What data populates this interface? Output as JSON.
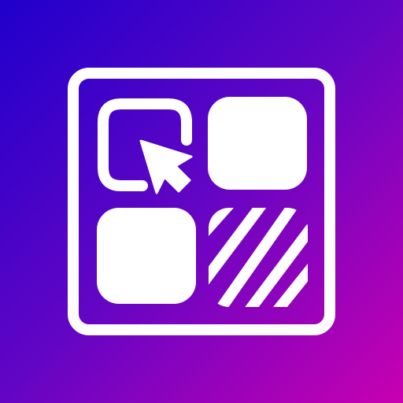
{
  "icon": {
    "name": "grid-select-app-icon",
    "background_gradient": [
      "#2300c8",
      "#6a06c4",
      "#c200b2"
    ],
    "foreground_color": "#ffffff",
    "tiles": [
      {
        "position": "top-left",
        "style": "outline-selected"
      },
      {
        "position": "top-right",
        "style": "filled"
      },
      {
        "position": "bottom-left",
        "style": "filled"
      },
      {
        "position": "bottom-right",
        "style": "striped"
      }
    ],
    "cursor": "arrow-pointer-icon"
  }
}
